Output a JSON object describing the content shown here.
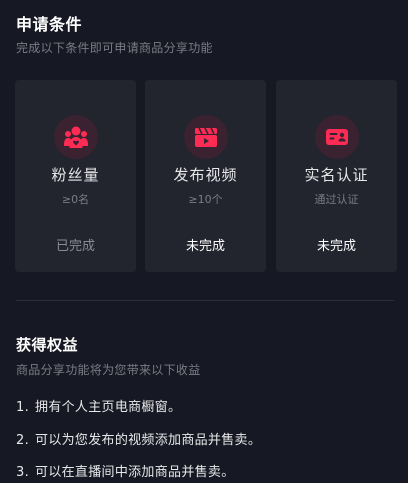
{
  "conditions": {
    "title": "申请条件",
    "subtitle": "完成以下条件即可申请商品分享功能",
    "cards": [
      {
        "name": "粉丝量",
        "requirement": "≥0名",
        "status": "已完成",
        "icon": "fans-icon",
        "completed": true
      },
      {
        "name": "发布视频",
        "requirement": "≥10个",
        "status": "未完成",
        "icon": "video-clapper-icon",
        "completed": false
      },
      {
        "name": "实名认证",
        "requirement": "通过认证",
        "status": "未完成",
        "icon": "id-card-icon",
        "completed": false
      }
    ]
  },
  "benefits": {
    "title": "获得权益",
    "subtitle": "商品分享功能将为您带来以下收益",
    "items": [
      {
        "num": "1.",
        "text": "拥有个人主页电商橱窗。"
      },
      {
        "num": "2.",
        "text": "可以为您发布的视频添加商品并售卖。"
      },
      {
        "num": "3.",
        "text": "可以在直播间中添加商品并售卖。"
      }
    ]
  },
  "colors": {
    "background": "#161823",
    "card": "#22242e",
    "accent": "#fe2c55"
  }
}
